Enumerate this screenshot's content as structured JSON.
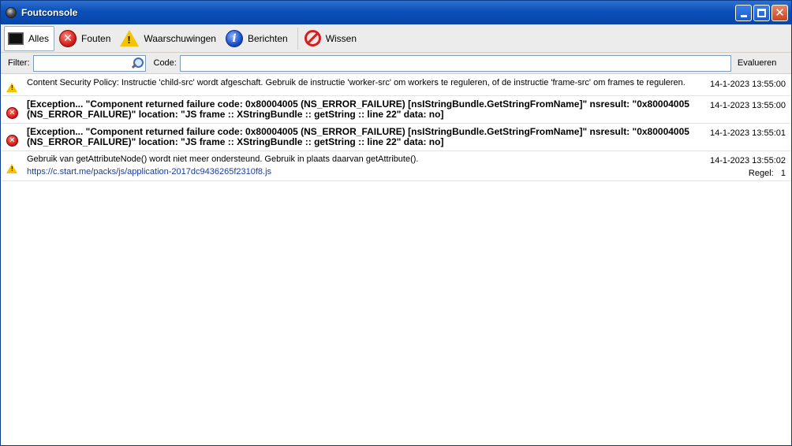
{
  "window": {
    "title": "Foutconsole"
  },
  "toolbar": {
    "all_label": "Alles",
    "errors_label": "Fouten",
    "warnings_label": "Waarschuwingen",
    "messages_label": "Berichten",
    "clear_label": "Wissen"
  },
  "filterbar": {
    "filter_label": "Filter:",
    "filter_value": "",
    "code_label": "Code:",
    "code_value": "",
    "evaluate_label": "Evalueren"
  },
  "messages": [
    {
      "type": "warning",
      "text": "Content Security Policy: Instructie 'child-src' wordt afgeschaft. Gebruik de instructie 'worker-src' om workers te reguleren, of de instructie 'frame-src' om frames te reguleren.",
      "time": "14-1-2023 13:55:00"
    },
    {
      "type": "error",
      "text": "[Exception... \"Component returned failure code: 0x80004005 (NS_ERROR_FAILURE) [nsIStringBundle.GetStringFromName]\"  nsresult: \"0x80004005 (NS_ERROR_FAILURE)\"  location: \"JS frame :: XStringBundle :: getString :: line 22\"  data: no]",
      "time": "14-1-2023 13:55:00"
    },
    {
      "type": "error",
      "text": "[Exception... \"Component returned failure code: 0x80004005 (NS_ERROR_FAILURE) [nsIStringBundle.GetStringFromName]\"  nsresult: \"0x80004005 (NS_ERROR_FAILURE)\"  location: \"JS frame :: XStringBundle :: getString :: line 22\"  data: no]",
      "time": "14-1-2023 13:55:01"
    },
    {
      "type": "warning",
      "text": "Gebruik van getAttributeNode() wordt niet meer ondersteund. Gebruik in plaats daarvan getAttribute().",
      "link": "https://c.start.me/packs/js/application-2017dc9436265f2310f8.js",
      "time": "14-1-2023 13:55:02",
      "line_label": "Regel:",
      "line_value": "1"
    }
  ],
  "icons": {
    "all": "terminal-icon",
    "errors": "error-icon",
    "warnings": "warning-icon",
    "messages": "info-icon",
    "clear": "clear-icon",
    "search": "search-icon"
  },
  "colors": {
    "titlebar": "#0a4fb8",
    "link": "#1a3c9c",
    "error": "#d42020",
    "warning": "#f5c400",
    "info": "#1d4fc8"
  }
}
